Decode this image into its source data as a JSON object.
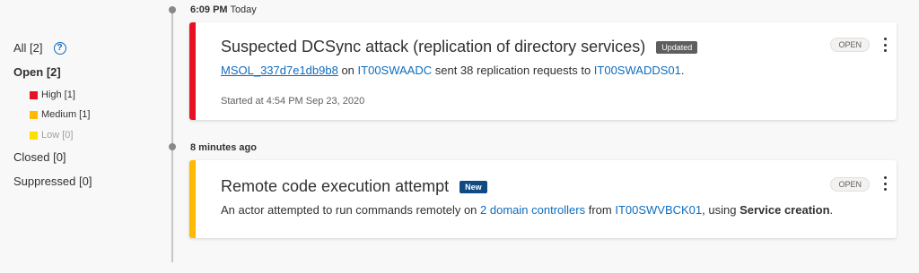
{
  "filters": {
    "all": "All [2]",
    "open": "Open [2]",
    "severities": [
      {
        "label": "High [1]",
        "color": "#e81123"
      },
      {
        "label": "Medium [1]",
        "color": "#ffb900"
      },
      {
        "label": "Low [0]",
        "color": "#fce100"
      }
    ],
    "closed": "Closed [0]",
    "suppressed": "Suppressed [0]"
  },
  "timeline": [
    {
      "time": "6:09 PM",
      "day": "Today"
    },
    {
      "time": "8 minutes ago"
    }
  ],
  "alerts": [
    {
      "title": "Suspected DCSync attack (replication of directory services)",
      "badge": "Updated",
      "status": "OPEN",
      "accent": "#e81123",
      "desc": {
        "account": "MSOL_337d7e1db9b8",
        "t1": " on ",
        "source": "IT00SWAADC",
        "t2": " sent 38 replication requests to ",
        "target": "IT00SWADDS01",
        "t3": "."
      },
      "started": "Started at 4:54 PM Sep 23, 2020"
    },
    {
      "title": "Remote code execution attempt",
      "badge": "New",
      "status": "OPEN",
      "accent": "#ffb900",
      "desc": {
        "t1": "An actor attempted to run commands remotely on ",
        "targets": "2 domain controllers",
        "t2": " from ",
        "source": "IT00SWVBCK01",
        "t3": ", using ",
        "method": "Service creation",
        "t4": "."
      }
    }
  ]
}
